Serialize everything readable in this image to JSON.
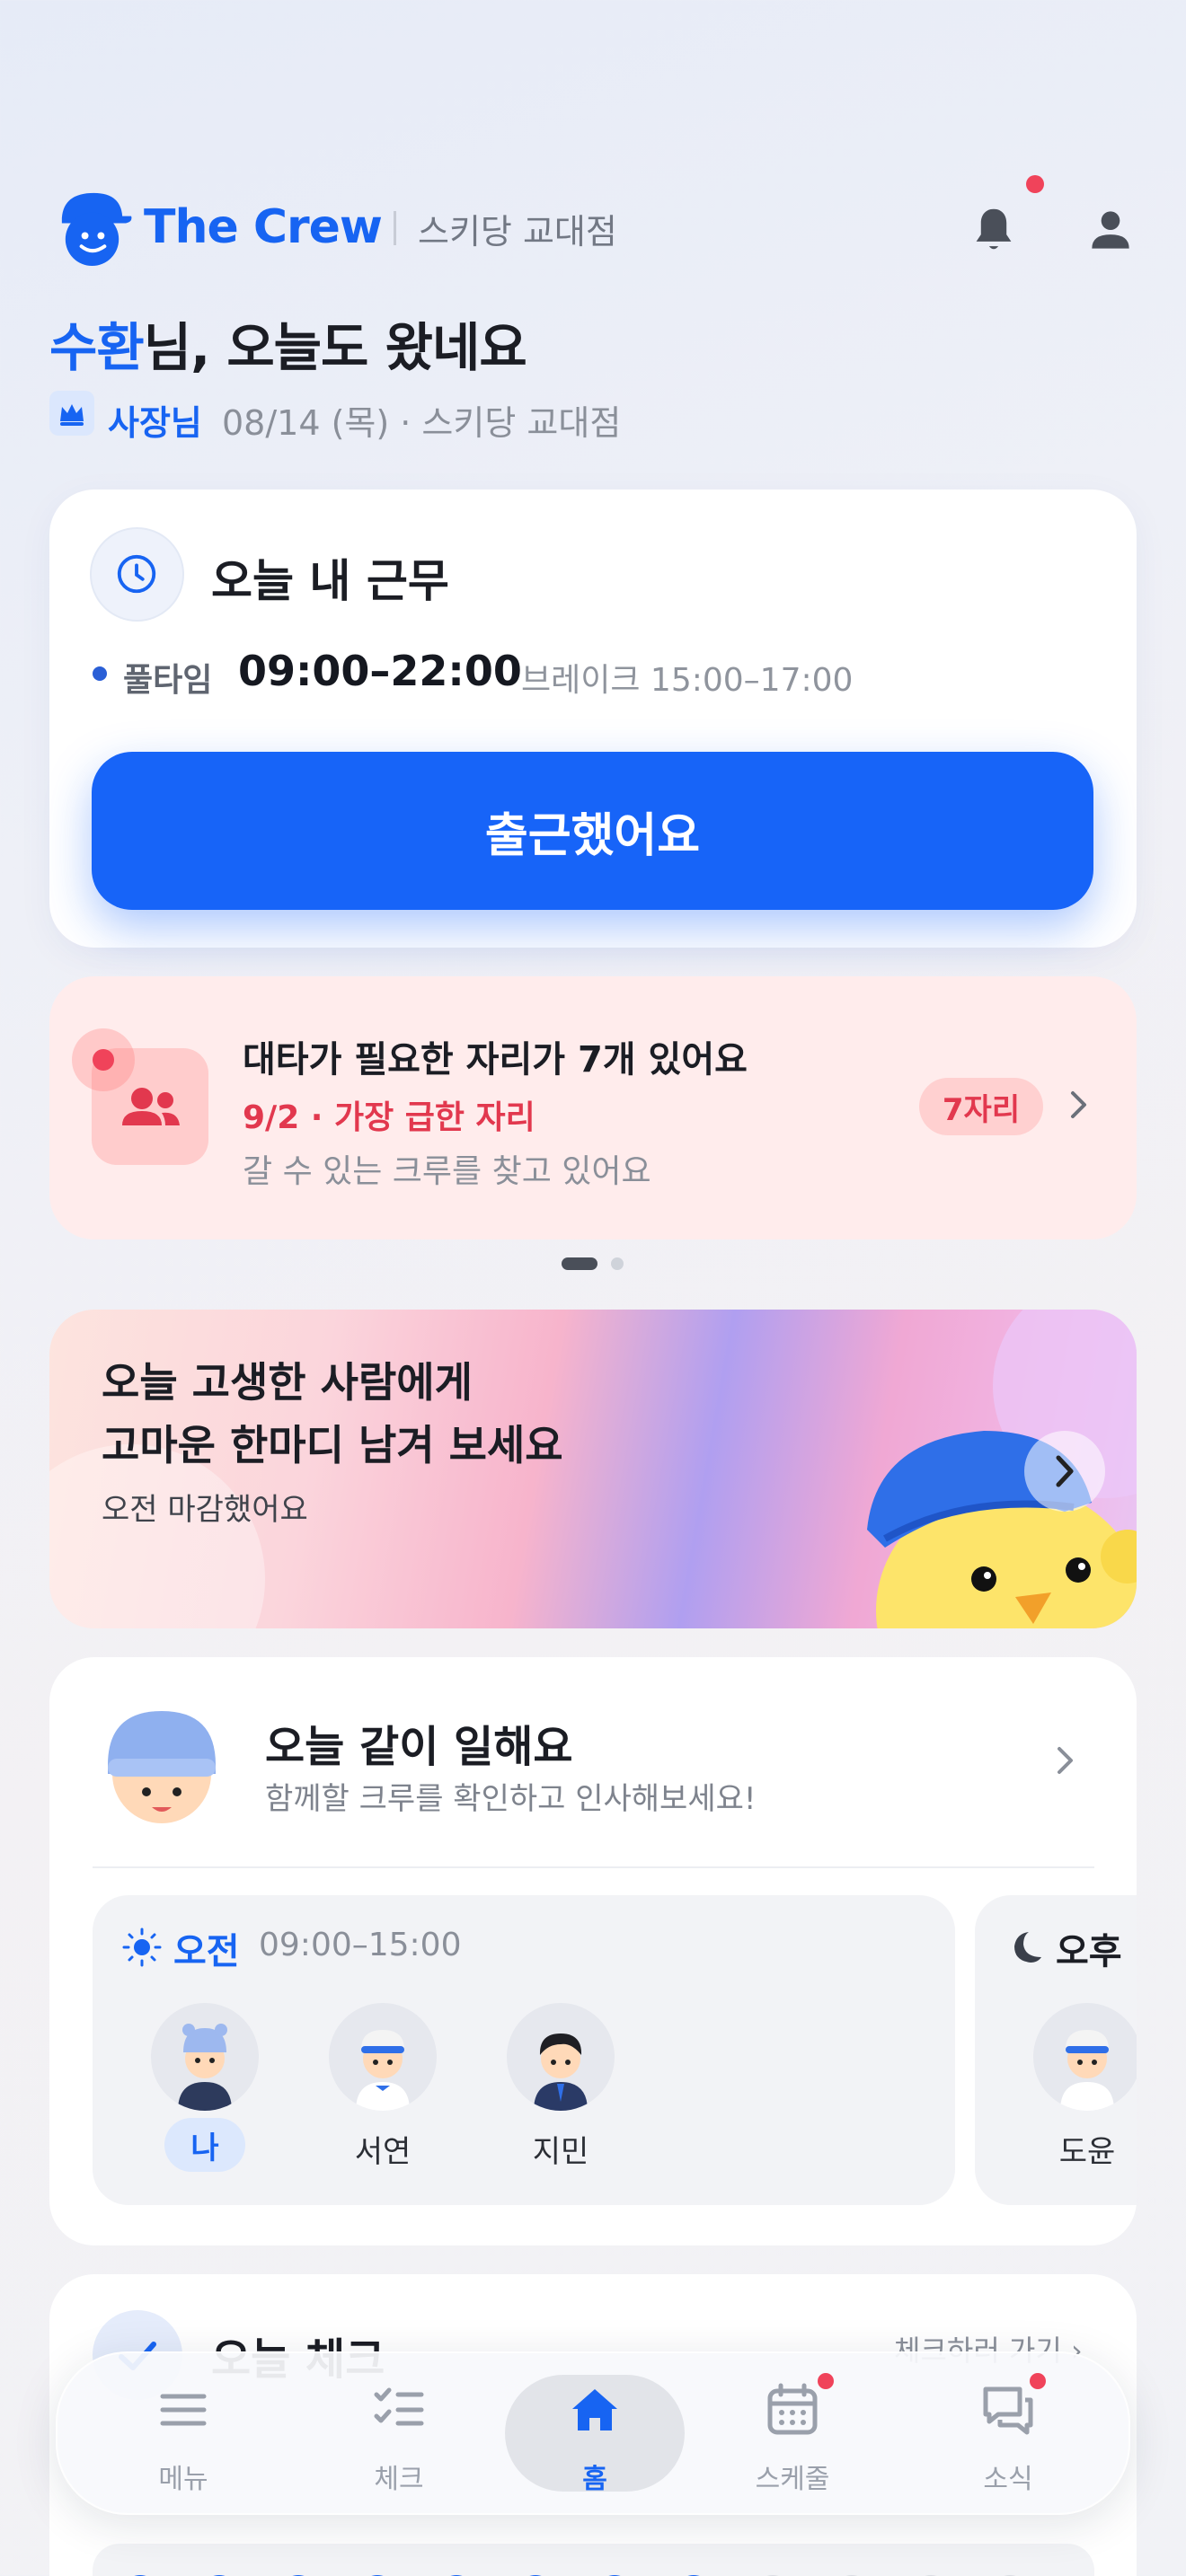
{
  "header": {
    "brand": "The Crew",
    "store": "스키당 교대점"
  },
  "greeting": {
    "name": "수환",
    "rest": "님, 오늘도 왔네요"
  },
  "role_row": {
    "role": "사장님",
    "date_store": "08/14 (목) · 스키당 교대점"
  },
  "work_card": {
    "title": "오늘 내 근무",
    "type": "풀타임",
    "time": "09:00–22:00",
    "break": "브레이크 15:00–17:00",
    "button": "출근했어요"
  },
  "sub_card": {
    "title": "대타가 필요한 자리가 7개 있어요",
    "urgent": "9/2 · 가장 급한 자리",
    "desc": "갈 수 있는 크루를 찾고 있어요",
    "badge": "7자리"
  },
  "pager": {
    "total": 2,
    "active": 1
  },
  "banner": {
    "line1": "오늘 고생한 사람에게",
    "line2": "고마운 한마디 남겨 보세요",
    "sub": "오전 마감했어요"
  },
  "crew_card": {
    "title": "오늘 같이 일해요",
    "desc": "함께할 크루를 확인하고 인사해보세요!",
    "am": {
      "label": "오전",
      "time": "09:00–15:00",
      "members": [
        "나",
        "서연",
        "지민"
      ]
    },
    "pm": {
      "label": "오후",
      "members": [
        "도윤"
      ]
    }
  },
  "check_card": {
    "title": "오늘 체크",
    "link": "체크하러 가기 ›"
  },
  "nav": {
    "items": [
      {
        "label": "메뉴",
        "icon": "menu-icon"
      },
      {
        "label": "체크",
        "icon": "checklist-icon"
      },
      {
        "label": "홈",
        "icon": "home-icon"
      },
      {
        "label": "스케줄",
        "icon": "calendar-icon"
      },
      {
        "label": "소식",
        "icon": "chat-icon"
      }
    ],
    "active": "홈"
  },
  "colors": {
    "accent": "#1764f2",
    "alert": "#f0435a",
    "urgent_text": "#e2384e"
  }
}
